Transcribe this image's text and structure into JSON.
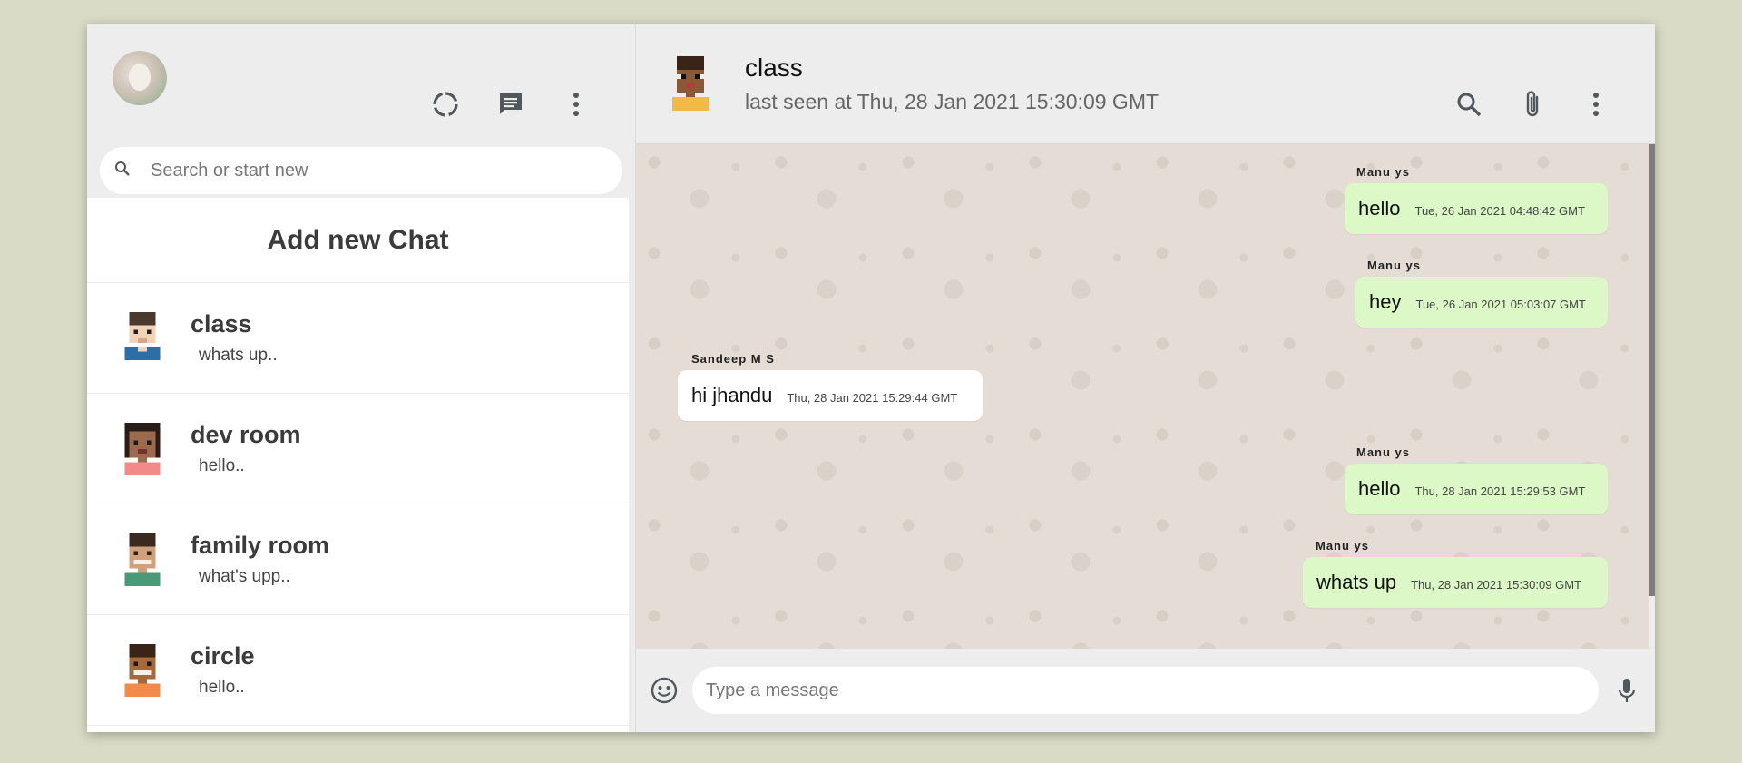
{
  "sidebar": {
    "search_placeholder": "Search or start new",
    "add_chat_label": "Add new Chat",
    "chats": [
      {
        "name": "class",
        "last": "whats up.."
      },
      {
        "name": "dev room",
        "last": "hello.."
      },
      {
        "name": "family room",
        "last": "what's upp.."
      },
      {
        "name": "circle",
        "last": "hello.."
      }
    ]
  },
  "chat": {
    "name": "class",
    "status": "last seen at Thu, 28 Jan 2021 15:30:09 GMT",
    "messages": [
      {
        "sender": "Manu ys",
        "text": "hello",
        "time": "Tue, 26 Jan 2021 04:48:42 GMT",
        "direction": "out"
      },
      {
        "sender": "Manu ys",
        "text": "hey",
        "time": "Tue, 26 Jan 2021 05:03:07 GMT",
        "direction": "out"
      },
      {
        "sender": "Sandeep M S",
        "text": "hi jhandu",
        "time": "Thu, 28 Jan 2021 15:29:44 GMT",
        "direction": "in"
      },
      {
        "sender": "Manu ys",
        "text": "hello",
        "time": "Thu, 28 Jan 2021 15:29:53 GMT",
        "direction": "out"
      },
      {
        "sender": "Manu ys",
        "text": "whats up",
        "time": "Thu, 28 Jan 2021 15:30:09 GMT",
        "direction": "out"
      }
    ],
    "composer_placeholder": "Type a message"
  },
  "icons": {
    "status": "status-icon",
    "new_chat": "new-chat-icon",
    "menu": "more-vertical-icon",
    "search": "search-icon",
    "attach": "paperclip-icon",
    "emoji": "emoji-icon",
    "mic": "microphone-icon"
  },
  "colors": {
    "background": "#dadbc6",
    "panel": "#ededed",
    "outgoing_bubble": "#dcf8c6",
    "incoming_bubble": "#ffffff",
    "chat_wallpaper": "#e5ddd5"
  }
}
